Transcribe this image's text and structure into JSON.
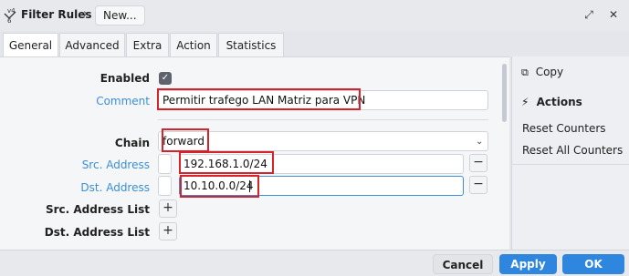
{
  "window": {
    "title": "Filter Rules",
    "breadcrumb_sep": "›",
    "breadcrumb_item": "New..."
  },
  "tabs": [
    {
      "label": "General",
      "active": true
    },
    {
      "label": "Advanced"
    },
    {
      "label": "Extra"
    },
    {
      "label": "Action"
    },
    {
      "label": "Statistics"
    }
  ],
  "form": {
    "enabled_label": "Enabled",
    "comment_label": "Comment",
    "comment_value": "Permitir trafego LAN Matriz para VPN",
    "chain_label": "Chain",
    "chain_value": "forward",
    "src_address_label": "Src. Address",
    "src_address_value": "192.168.1.0/24",
    "dst_address_label": "Dst. Address",
    "dst_address_value": "10.10.0.0/24",
    "src_list_label": "Src. Address List",
    "dst_list_label": "Dst. Address List"
  },
  "side_panel": {
    "copy_label": "Copy",
    "actions_label": "Actions",
    "reset_counters": "Reset Counters",
    "reset_all_counters": "Reset All Counters"
  },
  "footer": {
    "cancel": "Cancel",
    "apply": "Apply",
    "ok": "OK"
  },
  "colors": {
    "accent": "#2e86de",
    "highlight_box": "#d6232b",
    "blue_label": "#3a8fd6"
  }
}
